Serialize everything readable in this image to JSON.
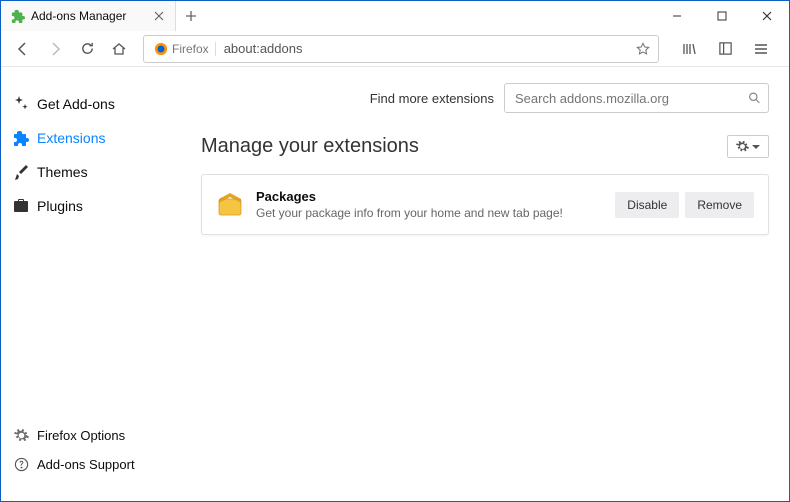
{
  "tab": {
    "title": "Add-ons Manager"
  },
  "urlbar": {
    "identity": "Firefox",
    "url": "about:addons"
  },
  "sidebar": {
    "items": [
      {
        "label": "Get Add-ons"
      },
      {
        "label": "Extensions"
      },
      {
        "label": "Themes"
      },
      {
        "label": "Plugins"
      }
    ],
    "footer": [
      {
        "label": "Firefox Options"
      },
      {
        "label": "Add-ons Support"
      }
    ]
  },
  "main": {
    "find_label": "Find more extensions",
    "find_placeholder": "Search addons.mozilla.org",
    "heading": "Manage your extensions",
    "extension": {
      "name": "Packages",
      "desc": "Get your package info from your home and new tab page!",
      "disable": "Disable",
      "remove": "Remove"
    }
  }
}
